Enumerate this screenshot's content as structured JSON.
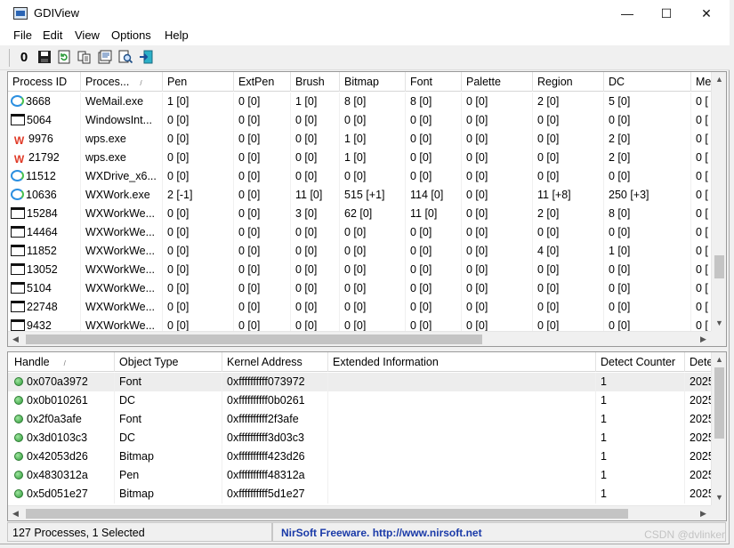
{
  "window": {
    "title": "GDIView",
    "minimize": "—",
    "maximize": "☐",
    "close": "✕"
  },
  "menu": [
    "File",
    "Edit",
    "View",
    "Options",
    "Help"
  ],
  "toolbar": {
    "icons": [
      "properties-icon",
      "save-icon",
      "refresh-icon",
      "copy-icon",
      "report-icon",
      "find-icon",
      "exit-icon"
    ],
    "zero_label": "0"
  },
  "processes": {
    "columns": [
      "Process ID",
      "Proces...",
      "Pen",
      "ExtPen",
      "Brush",
      "Bitmap",
      "Font",
      "Palette",
      "Region",
      "DC",
      "Me"
    ],
    "rows": [
      {
        "icon": "bubble",
        "cells": [
          "3668",
          "WeMail.exe",
          "1  [0]",
          "0  [0]",
          "1  [0]",
          "8  [0]",
          "8  [0]",
          "0  [0]",
          "2  [0]",
          "5  [0]",
          "0  ["
        ]
      },
      {
        "icon": "win",
        "cells": [
          "5064",
          "WindowsInt...",
          "0  [0]",
          "0  [0]",
          "0  [0]",
          "0  [0]",
          "0  [0]",
          "0  [0]",
          "0  [0]",
          "0  [0]",
          "0  ["
        ]
      },
      {
        "icon": "wps",
        "cells": [
          "9976",
          "wps.exe",
          "0  [0]",
          "0  [0]",
          "0  [0]",
          "1  [0]",
          "0  [0]",
          "0  [0]",
          "0  [0]",
          "2  [0]",
          "0  ["
        ]
      },
      {
        "icon": "wps",
        "cells": [
          "21792",
          "wps.exe",
          "0  [0]",
          "0  [0]",
          "0  [0]",
          "1  [0]",
          "0  [0]",
          "0  [0]",
          "0  [0]",
          "2  [0]",
          "0  ["
        ]
      },
      {
        "icon": "bubble",
        "cells": [
          "11512",
          "WXDrive_x6...",
          "0  [0]",
          "0  [0]",
          "0  [0]",
          "0  [0]",
          "0  [0]",
          "0  [0]",
          "0  [0]",
          "0  [0]",
          "0  ["
        ]
      },
      {
        "icon": "bubble",
        "cells": [
          "10636",
          "WXWork.exe",
          "2  [-1]",
          "0  [0]",
          "11  [0]",
          "515  [+1]",
          "114  [0]",
          "0  [0]",
          "11  [+8]",
          "250  [+3]",
          "0  ["
        ]
      },
      {
        "icon": "win",
        "cells": [
          "15284",
          "WXWorkWe...",
          "0  [0]",
          "0  [0]",
          "3  [0]",
          "62  [0]",
          "11  [0]",
          "0  [0]",
          "2  [0]",
          "8  [0]",
          "0  ["
        ]
      },
      {
        "icon": "win",
        "cells": [
          "14464",
          "WXWorkWe...",
          "0  [0]",
          "0  [0]",
          "0  [0]",
          "0  [0]",
          "0  [0]",
          "0  [0]",
          "0  [0]",
          "0  [0]",
          "0  ["
        ]
      },
      {
        "icon": "win",
        "cells": [
          "11852",
          "WXWorkWe...",
          "0  [0]",
          "0  [0]",
          "0  [0]",
          "0  [0]",
          "0  [0]",
          "0  [0]",
          "4  [0]",
          "1  [0]",
          "0  ["
        ]
      },
      {
        "icon": "win",
        "cells": [
          "13052",
          "WXWorkWe...",
          "0  [0]",
          "0  [0]",
          "0  [0]",
          "0  [0]",
          "0  [0]",
          "0  [0]",
          "0  [0]",
          "0  [0]",
          "0  ["
        ]
      },
      {
        "icon": "win",
        "cells": [
          "5104",
          "WXWorkWe...",
          "0  [0]",
          "0  [0]",
          "0  [0]",
          "0  [0]",
          "0  [0]",
          "0  [0]",
          "0  [0]",
          "0  [0]",
          "0  ["
        ]
      },
      {
        "icon": "win",
        "cells": [
          "22748",
          "WXWorkWe...",
          "0  [0]",
          "0  [0]",
          "0  [0]",
          "0  [0]",
          "0  [0]",
          "0  [0]",
          "0  [0]",
          "0  [0]",
          "0  ["
        ]
      },
      {
        "icon": "win",
        "cells": [
          "9432",
          "WXWorkWe...",
          "0  [0]",
          "0  [0]",
          "0  [0]",
          "0  [0]",
          "0  [0]",
          "0  [0]",
          "0  [0]",
          "0  [0]",
          "0  ["
        ]
      }
    ]
  },
  "objects": {
    "columns": [
      "Handle",
      "Object Type",
      "Kernel Address",
      "Extended Information",
      "Detect Counter",
      "Dete"
    ],
    "rows": [
      {
        "cells": [
          "0x070a3972",
          "Font",
          "0xffffffffff073972",
          "",
          "1",
          "2025"
        ]
      },
      {
        "cells": [
          "0x0b010261",
          "DC",
          "0xffffffffff0b0261",
          "",
          "1",
          "2025"
        ]
      },
      {
        "cells": [
          "0x2f0a3afe",
          "Font",
          "0xffffffffff2f3afe",
          "",
          "1",
          "2025"
        ]
      },
      {
        "cells": [
          "0x3d0103c3",
          "DC",
          "0xffffffffff3d03c3",
          "",
          "1",
          "2025"
        ]
      },
      {
        "cells": [
          "0x42053d26",
          "Bitmap",
          "0xffffffffff423d26",
          "",
          "1",
          "2025"
        ]
      },
      {
        "cells": [
          "0x4830312a",
          "Pen",
          "0xffffffffff48312a",
          "",
          "1",
          "2025"
        ]
      },
      {
        "cells": [
          "0x5d051e27",
          "Bitmap",
          "0xffffffffff5d1e27",
          "",
          "1",
          "2025"
        ]
      }
    ]
  },
  "status": {
    "counts": "127 Processes, 1 Selected",
    "freeware": "NirSoft Freeware.  http://www.nirsoft.net"
  },
  "watermark": "CSDN @dvlinker",
  "colors": {
    "link": "#1a3aa8",
    "wps_red": "#e03a27",
    "status_dot": "#2f9a3a"
  }
}
